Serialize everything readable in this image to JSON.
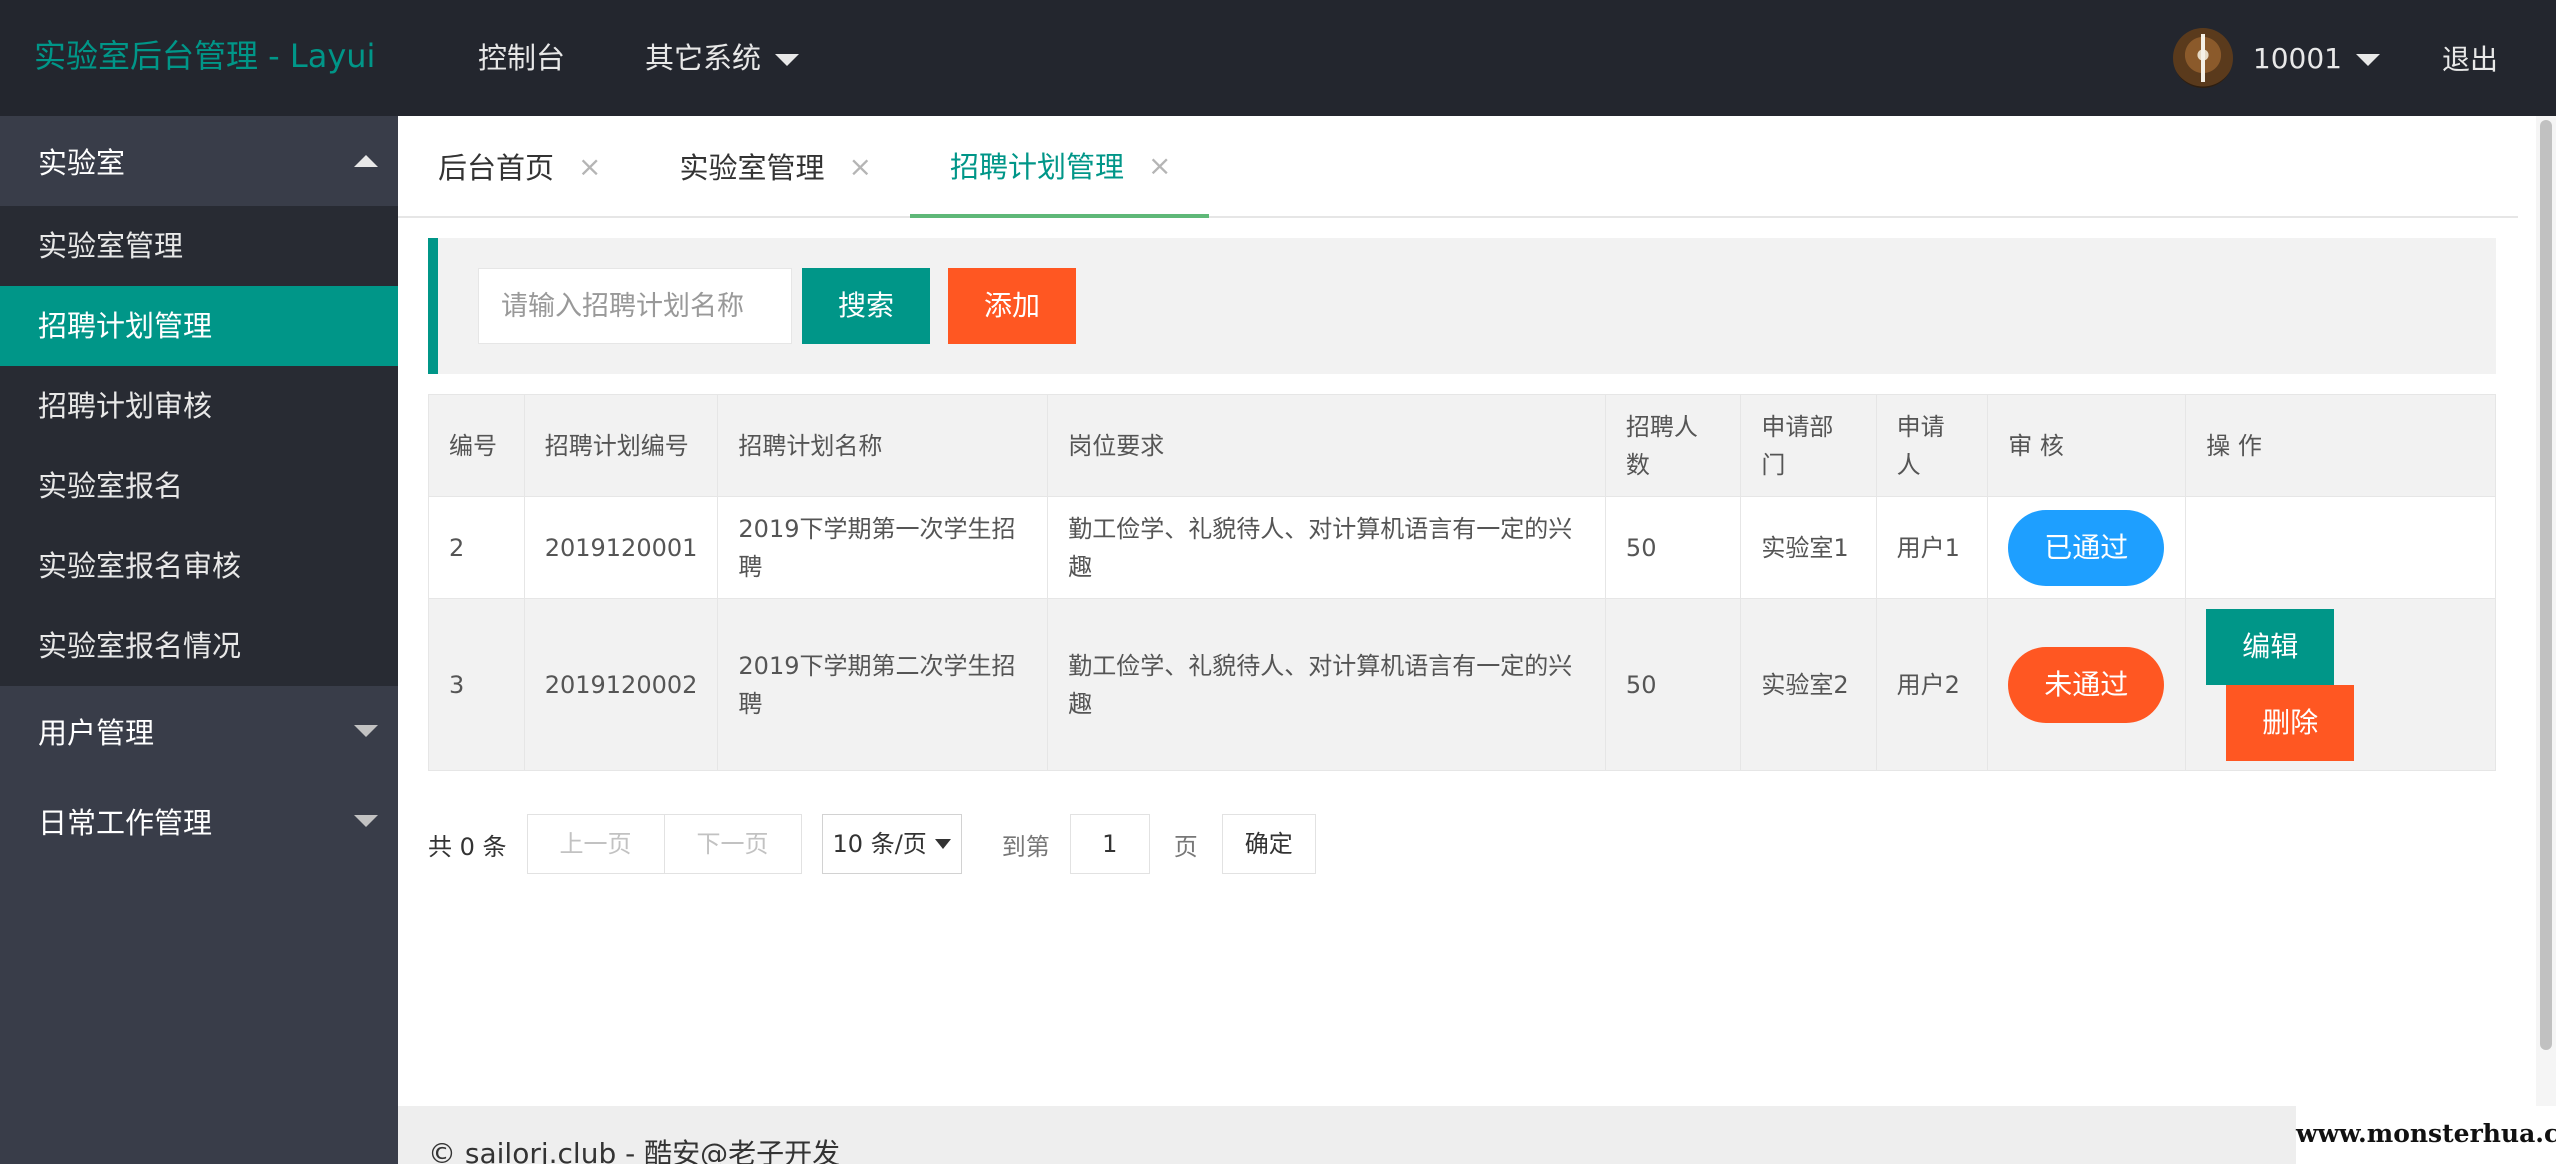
{
  "header": {
    "logo": "实验室后台管理 - Layui",
    "nav": [
      {
        "label": "控制台"
      },
      {
        "label": "其它系统"
      }
    ],
    "user": {
      "name": "10001",
      "logout": "退出"
    }
  },
  "sidebar": {
    "groups": [
      {
        "label": "实验室",
        "children": [
          "实验室管理",
          "招聘计划管理",
          "招聘计划审核",
          "实验室报名",
          "实验室报名审核",
          "实验室报名情况"
        ]
      },
      {
        "label": "用户管理"
      },
      {
        "label": "日常工作管理"
      }
    ]
  },
  "tabs": [
    {
      "label": "后台首页",
      "close": "×"
    },
    {
      "label": "实验室管理",
      "close": "×"
    },
    {
      "label": "招聘计划管理",
      "close": "×"
    }
  ],
  "search": {
    "placeholder": "请输入招聘计划名称",
    "search_label": "搜索",
    "add_label": "添加"
  },
  "table": {
    "headers": [
      "编号",
      "招聘计划编号",
      "招聘计划名称",
      "岗位要求",
      "招聘人数",
      "申请部门",
      "申请人",
      "审 核",
      "操 作"
    ],
    "rows": [
      {
        "id": "2",
        "plan_no": "2019120001",
        "name": "2019下学期第一次学生招聘",
        "req": "勤工俭学、礼貌待人、对计算机语言有一定的兴趣",
        "count": "50",
        "dept": "实验室1",
        "applicant": "用户1",
        "status": "已通过"
      },
      {
        "id": "3",
        "plan_no": "2019120002",
        "name": "2019下学期第二次学生招聘",
        "req": "勤工俭学、礼貌待人、对计算机语言有一定的兴趣",
        "count": "50",
        "dept": "实验室2",
        "applicant": "用户2",
        "status": "未通过",
        "edit": "编辑",
        "delete": "删除"
      }
    ]
  },
  "pager": {
    "total": "共 0 条",
    "prev": "上一页",
    "next": "下一页",
    "limit": "10 条/页",
    "goto": "到第",
    "page_value": "1",
    "page_unit": "页",
    "confirm": "确定"
  },
  "footer": {
    "text": "© sailorj.club - 酷安@老子开发",
    "watermark": "www.monsterhua.com"
  },
  "colors": {
    "accent": "#009688",
    "danger": "#ff5722",
    "info": "#1e9fff",
    "header_bg": "#23262e",
    "sidebar_bg": "#393d49"
  }
}
